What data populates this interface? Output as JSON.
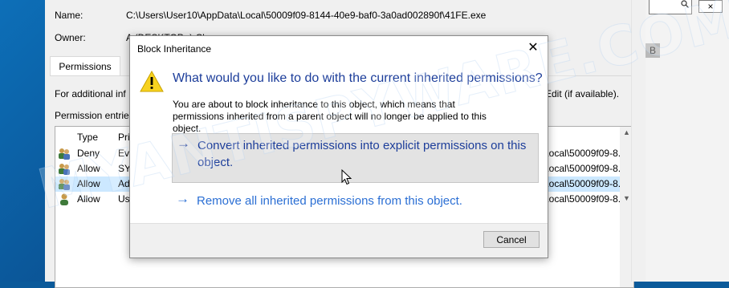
{
  "background_window": {
    "name_label": "Name:",
    "name_value": "C:\\Users\\User10\\AppData\\Local\\50009f09-8144-40e9-baf0-3a0ad002890f\\41FE.exe",
    "owner_label": "Owner:",
    "owner_value": "A            (DESKTOP-                       )      Ch",
    "tab_label": "Permissions",
    "additional_info_text": "For additional inf",
    "edit_hint_text": "Edit (if available).",
    "permission_entries_label": "Permission entrie",
    "columns": {
      "type": "Type",
      "principal": "Pri"
    },
    "rows": [
      {
        "type": "Deny",
        "principal": "Eve",
        "path": "Local\\50009f09-8..."
      },
      {
        "type": "Allow",
        "principal": "SYS",
        "path": "Local\\50009f09-8..."
      },
      {
        "type": "Allow",
        "principal": "Ad",
        "path": "Local\\50009f09-8..."
      },
      {
        "type": "Allow",
        "principal": "Use",
        "path": "Local\\50009f09-8..."
      }
    ],
    "selected_row_index": 2
  },
  "ghost_window": {
    "close_glyph": "×",
    "side_letter": "B"
  },
  "dialog": {
    "title": "Block Inheritance",
    "close_glyph": "✕",
    "question": "What would you like to do with the current inherited permissions?",
    "description": "You are about to block inheritance to this object, which means that permissions inherited from a parent object will no longer be applied to this object.",
    "option_convert": "Convert inherited permissions into explicit permissions on this object.",
    "option_remove": "Remove all inherited permissions from this object.",
    "arrow_glyph": "→",
    "cancel_label": "Cancel",
    "icons": {
      "warning": "warning-icon",
      "cursor": "mouse-pointer-icon"
    }
  },
  "watermark": "MYANTISPYWARE.COM",
  "colors": {
    "link_dark": "#1c3d9a",
    "link_light": "#2b6fd4",
    "hover_bg": "#e3e3e3",
    "selection_bg": "#cce8ff",
    "desktop_blue": "#0b5a9a"
  }
}
